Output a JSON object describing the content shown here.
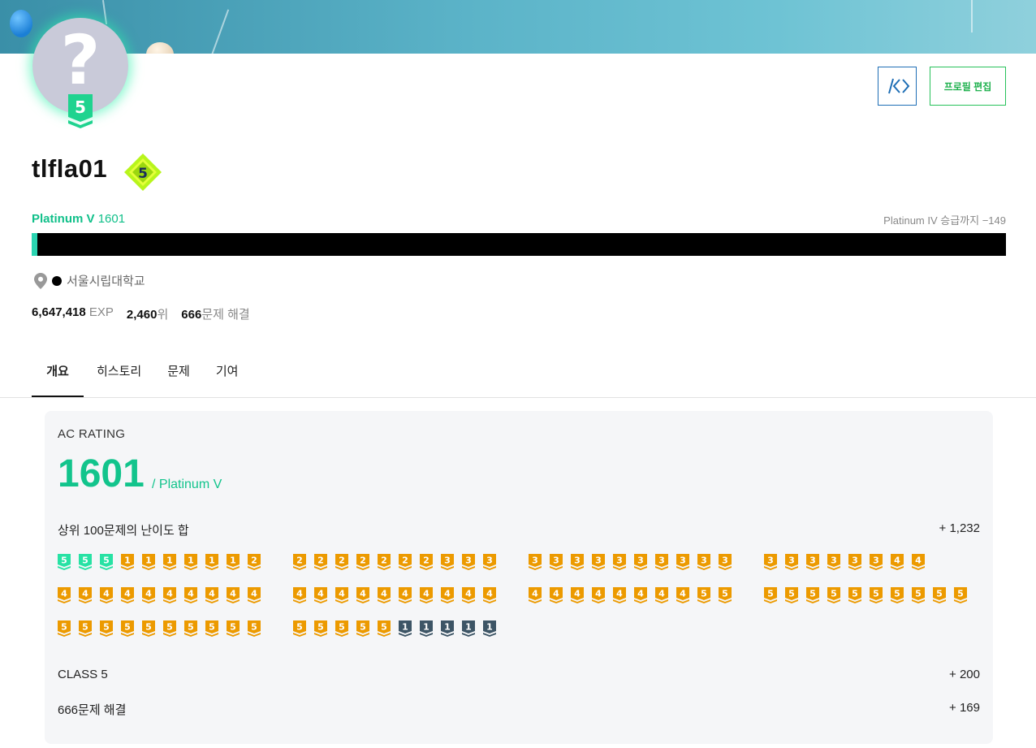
{
  "profile": {
    "username": "tlfla01",
    "avatar_question": "?",
    "class_badge": "5",
    "tier_badge": "5",
    "tier_name": "Platinum V",
    "rating": "1601",
    "next_tier_text": "Platinum IV 승급까지 −149",
    "progress_fraction": 0.006,
    "organization": "서울시립대학교",
    "exp_value": "6,647,418",
    "exp_unit": "EXP",
    "rank_value": "2,460",
    "rank_unit": "위",
    "solved_value": "666",
    "solved_unit": "문제 해결"
  },
  "buttons": {
    "code_label": "/<>",
    "edit_label": "프로필 편집"
  },
  "tabs": [
    {
      "label": "개요",
      "active": true
    },
    {
      "label": "히스토리",
      "active": false
    },
    {
      "label": "문제",
      "active": false
    },
    {
      "label": "기여",
      "active": false
    }
  ],
  "ac_rating": {
    "title": "AC RATING",
    "value": "1601",
    "suffix": "/ Platinum V",
    "top100_label": "상위 100문제의 난이도 합",
    "top100_value": "+ 1,232",
    "class_label": "CLASS 5",
    "class_value": "+ 200",
    "solved_label": "666문제 해결",
    "solved_value": "+ 169"
  },
  "colors": {
    "silver": "#2bd4a8",
    "gold": "#ec9a00",
    "platinum": "#27e2a4",
    "diamond": "#3d5566",
    "accent": "#12c48c"
  },
  "problem_badges": [
    [
      "s5",
      "s5",
      "s5",
      "g1",
      "g1",
      "g1",
      "g1",
      "g1",
      "g1",
      "g2",
      "g2",
      "g2",
      "g2",
      "g2",
      "g2",
      "g2",
      "g2",
      "g3",
      "g3",
      "g3",
      "g3",
      "g3",
      "g3",
      "g3",
      "g3",
      "g3",
      "g3",
      "g3",
      "g3",
      "g3",
      "g3",
      "g3",
      "g3",
      "g3",
      "g3",
      "g3",
      "g4",
      "g4"
    ],
    [
      "g4",
      "g4",
      "g4",
      "g4",
      "g4",
      "g4",
      "g4",
      "g4",
      "g4",
      "g4",
      "g4",
      "g4",
      "g4",
      "g4",
      "g4",
      "g4",
      "g4",
      "g4",
      "g4",
      "g4",
      "g4",
      "g4",
      "g4",
      "g4",
      "g4",
      "g4",
      "g4",
      "g4",
      "g5",
      "g5",
      "g5",
      "g5",
      "g5",
      "g5",
      "g5",
      "g5",
      "g5",
      "g5",
      "g5",
      "g5"
    ],
    [
      "g5",
      "g5",
      "g5",
      "g5",
      "g5",
      "g5",
      "g5",
      "g5",
      "g5",
      "g5",
      "g5",
      "g5",
      "g5",
      "g5",
      "g5",
      "d1",
      "d1",
      "d1",
      "d1",
      "d1"
    ]
  ]
}
